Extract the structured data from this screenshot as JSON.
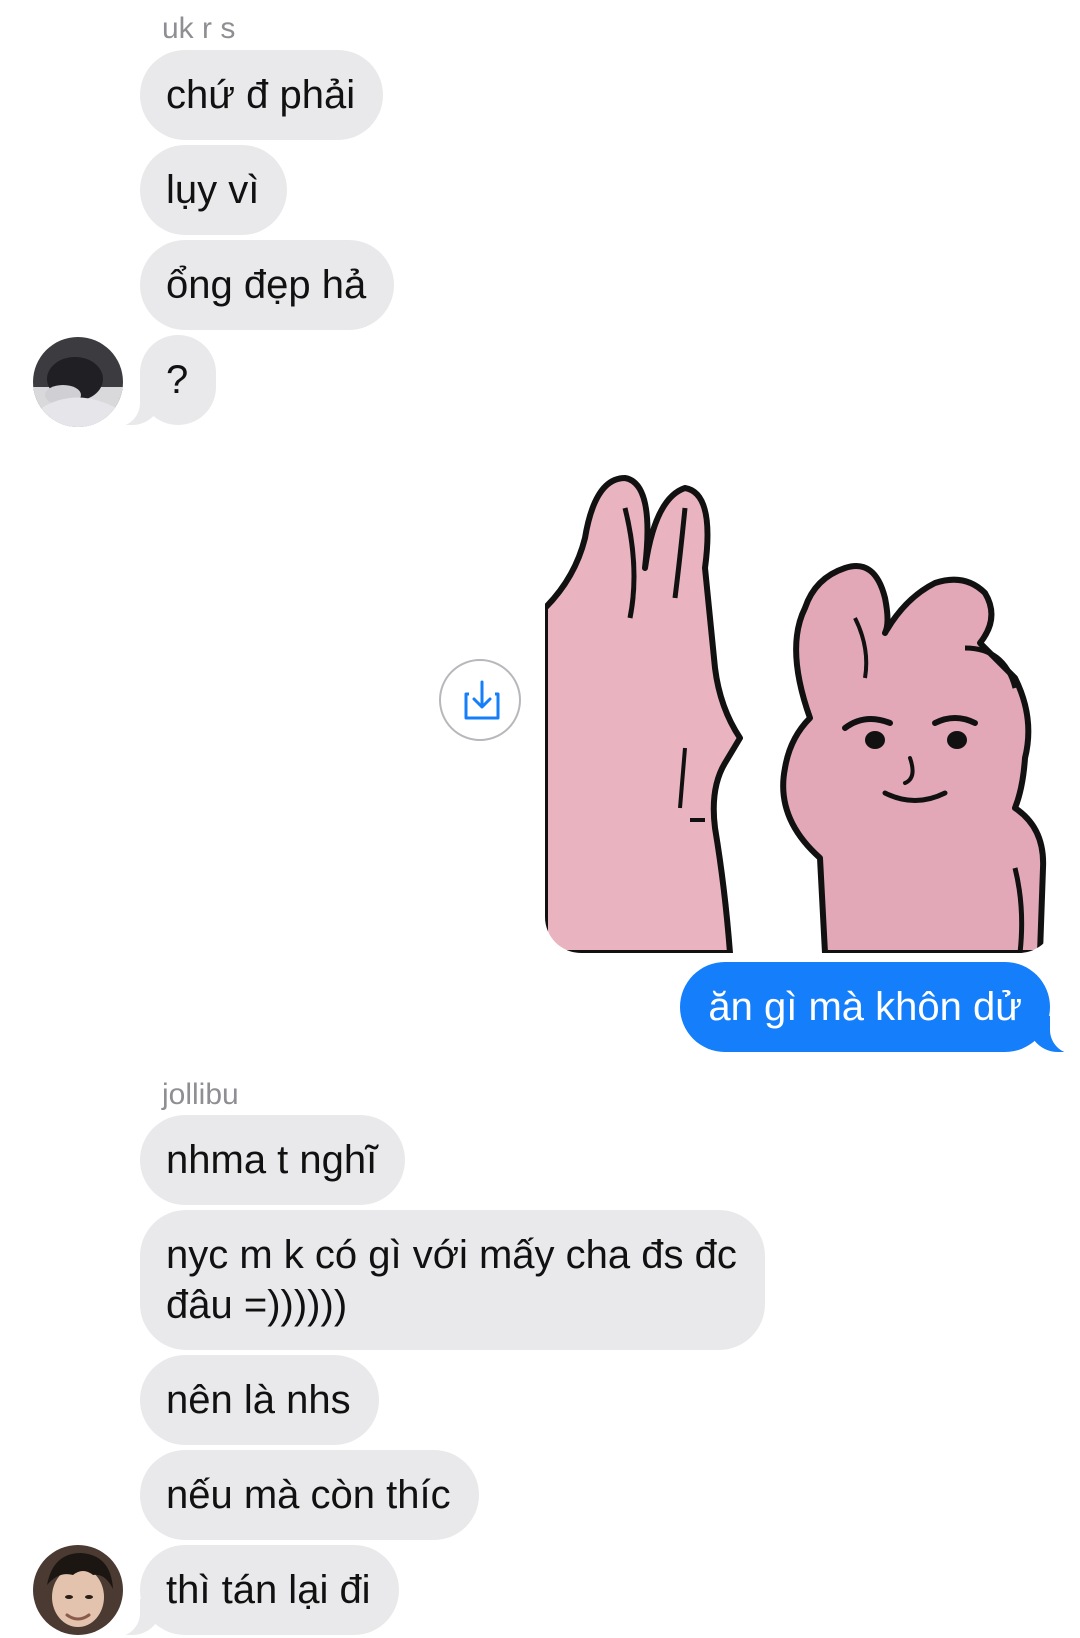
{
  "messages": {
    "group1": {
      "sender": "uk r s",
      "bubbles": [
        "chứ đ phải",
        "lụy vì",
        "ổng đẹp hả",
        "?"
      ],
      "avatar_icon": "avatar-photo-icon"
    },
    "image_message": {
      "image_icon": "rabbit-sticker-icon",
      "save_icon": "download-icon"
    },
    "outgoing": {
      "text": "ăn gì mà khôn dử"
    },
    "group2": {
      "sender": "jollibu",
      "bubbles": [
        "nhma t nghĩ",
        "nyc m k có gì với mấy cha đs đc đâu =))))))",
        "nên là nhs",
        "nếu mà còn thíc",
        "thì tán lại đi"
      ],
      "avatar_icon": "avatar-photo-icon"
    }
  },
  "colors": {
    "incoming_bubble": "#e9e9eb",
    "outgoing_bubble": "#147efb",
    "sender_name": "#8e8e93",
    "sticker_pink": "#e7aebb"
  }
}
